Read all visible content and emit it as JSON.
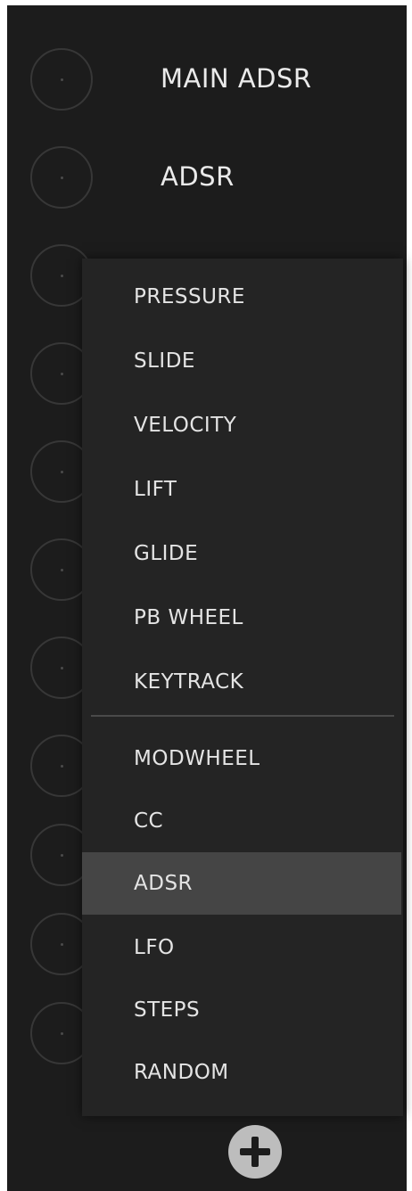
{
  "modulators": [
    {
      "label": "MAIN ADSR"
    },
    {
      "label": "ADSR"
    }
  ],
  "dropdown": {
    "items": [
      {
        "label": "PRESSURE"
      },
      {
        "label": "SLIDE"
      },
      {
        "label": "VELOCITY"
      },
      {
        "label": "LIFT"
      },
      {
        "label": "GLIDE"
      },
      {
        "label": "PB WHEEL"
      },
      {
        "label": "KEYTRACK"
      },
      {
        "label": "MODWHEEL"
      },
      {
        "label": "CC"
      },
      {
        "label": "ADSR"
      },
      {
        "label": "LFO"
      },
      {
        "label": "STEPS"
      },
      {
        "label": "RANDOM"
      }
    ],
    "selected": "ADSR"
  },
  "add_button": {
    "icon": "plus-circle-icon"
  },
  "colors": {
    "panel_bg": "#1c1c1c",
    "menu_bg": "#242424",
    "selected_bg": "#454545",
    "text": "#e4e4e4",
    "add_icon": "#bdbdbd"
  }
}
